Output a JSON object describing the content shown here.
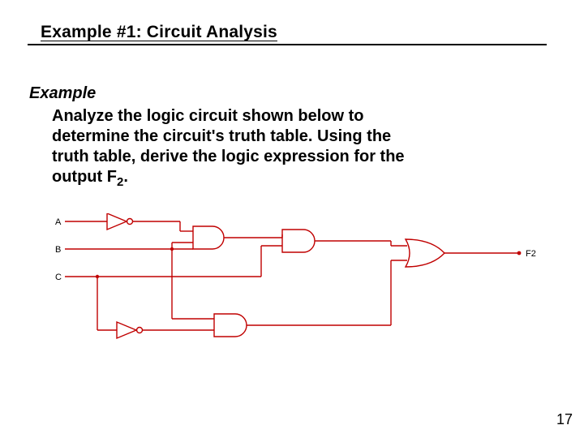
{
  "title": "Example #1: Circuit Analysis",
  "example_label": "Example",
  "body": {
    "line1": "Analyze the logic circuit shown below to",
    "line2": "determine the circuit's truth table. Using the",
    "line3": "truth table, derive the logic expression for the",
    "line4a": "output F",
    "line4sub": "2",
    "line4b": "."
  },
  "circuit": {
    "inputs": [
      "A",
      "B",
      "C"
    ],
    "output": "F2",
    "gates": [
      {
        "id": "not1",
        "type": "NOT",
        "inputs": [
          "A"
        ]
      },
      {
        "id": "not2",
        "type": "NOT",
        "inputs": [
          "C"
        ]
      },
      {
        "id": "and1",
        "type": "AND",
        "inputs": [
          "not1",
          "B"
        ]
      },
      {
        "id": "and2",
        "type": "AND",
        "inputs": [
          "and1",
          "C"
        ]
      },
      {
        "id": "and3",
        "type": "AND",
        "inputs": [
          "B",
          "not2"
        ]
      },
      {
        "id": "or1",
        "type": "OR",
        "inputs": [
          "and2",
          "and3"
        ],
        "output": "F2"
      }
    ]
  },
  "page_number": "17"
}
